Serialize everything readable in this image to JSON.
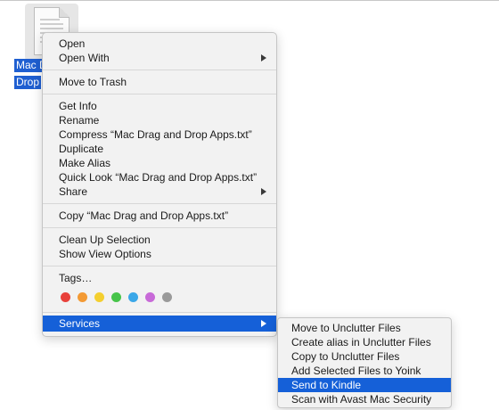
{
  "file": {
    "label_line1": "Mac D",
    "label_line2": "Drop",
    "icon": "text-document-icon"
  },
  "menu": {
    "groups": [
      [
        {
          "label": "Open"
        },
        {
          "label": "Open With",
          "submenu": true
        }
      ],
      [
        {
          "label": "Move to Trash"
        }
      ],
      [
        {
          "label": "Get Info"
        },
        {
          "label": "Rename"
        },
        {
          "label": "Compress “Mac Drag and Drop Apps.txt”"
        },
        {
          "label": "Duplicate"
        },
        {
          "label": "Make Alias"
        },
        {
          "label": "Quick Look “Mac Drag and Drop Apps.txt”"
        },
        {
          "label": "Share",
          "submenu": true
        }
      ],
      [
        {
          "label": "Copy “Mac Drag and Drop Apps.txt”"
        }
      ],
      [
        {
          "label": "Clean Up Selection"
        },
        {
          "label": "Show View Options"
        }
      ]
    ],
    "tags_label": "Tags…",
    "tag_colors": [
      "#e8413b",
      "#f39a34",
      "#f4cf2f",
      "#47c44a",
      "#3aa7e8",
      "#c86ad8",
      "#9a9a9a"
    ],
    "services_label": "Services"
  },
  "submenu": {
    "items": [
      "Move to Unclutter Files",
      "Create alias in Unclutter Files",
      "Copy to Unclutter Files",
      "Add Selected Files to Yoink",
      "Send to Kindle",
      "Scan with Avast Mac Security"
    ],
    "active_index": 4
  },
  "colors": {
    "highlight": "#1560d8",
    "menu_bg": "#f2f2f2"
  }
}
